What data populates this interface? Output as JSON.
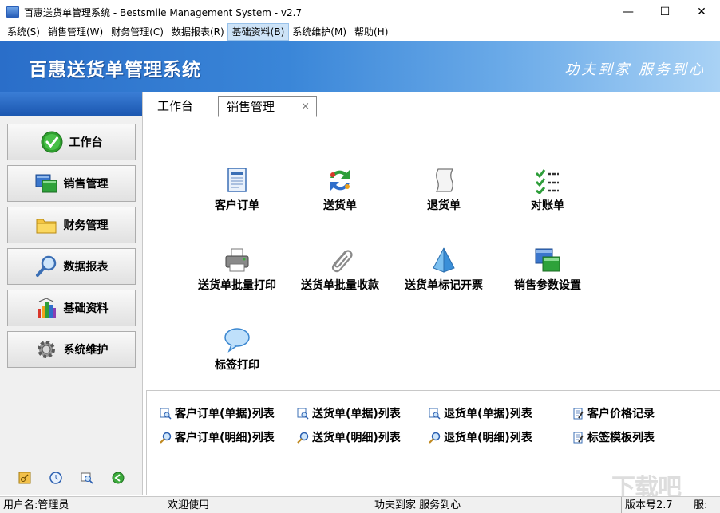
{
  "window": {
    "title": "百惠送货单管理系统 - Bestsmile Management System - v2.7",
    "min_glyph": "—",
    "max_glyph": "☐",
    "close_glyph": "✕"
  },
  "menu": [
    {
      "label": "系统(S)"
    },
    {
      "label": "销售管理(W)"
    },
    {
      "label": "财务管理(C)"
    },
    {
      "label": "数据报表(R)"
    },
    {
      "label": "基础资料(B)",
      "active": true
    },
    {
      "label": "系统维护(M)"
    },
    {
      "label": "帮助(H)"
    }
  ],
  "banner": {
    "brand": "百惠送货单管理系统",
    "slogan": "功夫到家 服务到心"
  },
  "sidebar": {
    "items": [
      {
        "label": "工作台",
        "icon": "checkmark-icon"
      },
      {
        "label": "销售管理",
        "icon": "windows-icon"
      },
      {
        "label": "财务管理",
        "icon": "folder-icon"
      },
      {
        "label": "数据报表",
        "icon": "magnifier-icon"
      },
      {
        "label": "基础资料",
        "icon": "palette-icon"
      },
      {
        "label": "系统维护",
        "icon": "gear-icon"
      }
    ],
    "tools": [
      "key-icon",
      "clock-icon",
      "search-icon",
      "back-icon"
    ]
  },
  "tabs": [
    {
      "label": "工作台"
    },
    {
      "label": "销售管理",
      "active": true,
      "close": "×"
    }
  ],
  "functions": [
    {
      "label": "客户订单",
      "icon": "order-form-icon"
    },
    {
      "label": "送货单",
      "icon": "refresh-arrows-icon"
    },
    {
      "label": "退货单",
      "icon": "scroll-icon"
    },
    {
      "label": "对账单",
      "icon": "checklist-icon"
    },
    {
      "label": "送货单批量打印",
      "icon": "printer-icon"
    },
    {
      "label": "送货单批量收款",
      "icon": "paperclip-icon"
    },
    {
      "label": "送货单标记开票",
      "icon": "pyramid-icon"
    },
    {
      "label": "销售参数设置",
      "icon": "windows-icon"
    },
    {
      "label": "标签打印",
      "icon": "speech-bubble-icon"
    }
  ],
  "list_links": [
    {
      "label": "客户订单(单据)列表",
      "icon": "list-search-icon"
    },
    {
      "label": "送货单(单据)列表",
      "icon": "list-search-icon"
    },
    {
      "label": "退货单(单据)列表",
      "icon": "list-search-icon"
    },
    {
      "label": "客户价格记录",
      "icon": "edit-doc-icon"
    },
    {
      "label": "客户订单(明细)列表",
      "icon": "detail-search-icon"
    },
    {
      "label": "送货单(明细)列表",
      "icon": "detail-search-icon"
    },
    {
      "label": "退货单(明细)列表",
      "icon": "detail-search-icon"
    },
    {
      "label": "标签模板列表",
      "icon": "edit-doc-icon"
    }
  ],
  "status": {
    "user": "用户名:管理员",
    "welcome": "欢迎使用",
    "slogan": "功夫到家 服务到心",
    "version": "版本号2.7",
    "extra": "服:"
  },
  "watermark": "下载吧"
}
